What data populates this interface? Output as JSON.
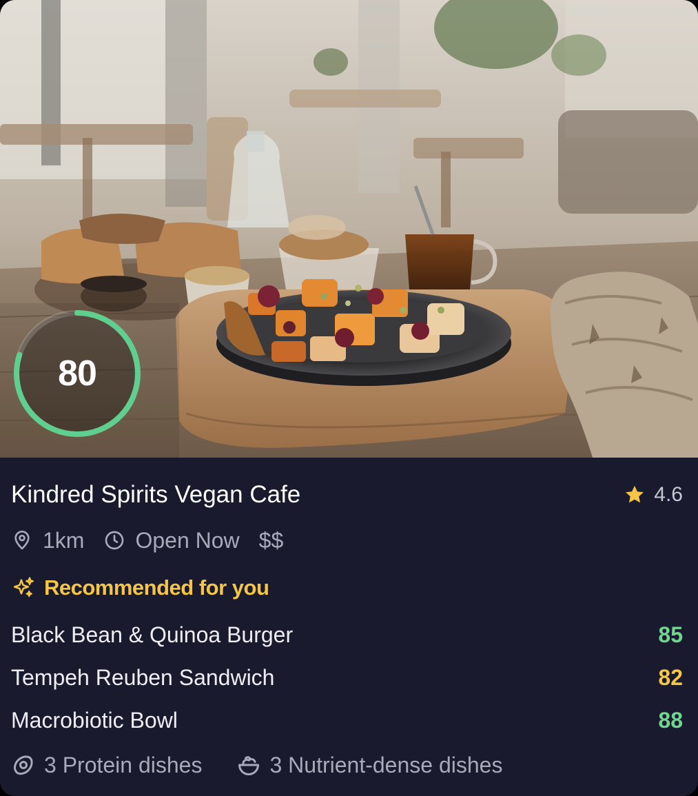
{
  "score": {
    "value": "80",
    "fraction": 0.8,
    "ring_color": "#5fcf8f"
  },
  "restaurant": {
    "name": "Kindred Spirits Vegan Cafe",
    "rating": "4.6",
    "rating_icon": "star-icon",
    "distance": "1km",
    "distance_icon": "location-pin-icon",
    "hours": "Open Now",
    "hours_icon": "clock-icon",
    "price": "$$"
  },
  "recommended": {
    "heading": "Recommended for you",
    "heading_icon": "sparkle-icon",
    "accent_color": "#f4c546",
    "dishes": [
      {
        "name": "Black Bean & Quinoa Burger",
        "score": "85",
        "color": "#6fd68f"
      },
      {
        "name": "Tempeh Reuben Sandwich",
        "score": "82",
        "color": "#f4c546"
      },
      {
        "name": "Macrobiotic Bowl",
        "score": "88",
        "color": "#6fd68f"
      }
    ]
  },
  "summary": {
    "protein": "3 Protein dishes",
    "protein_icon": "egg-icon",
    "nutrient": "3 Nutrient-dense dishes",
    "nutrient_icon": "salad-bowl-icon"
  }
}
